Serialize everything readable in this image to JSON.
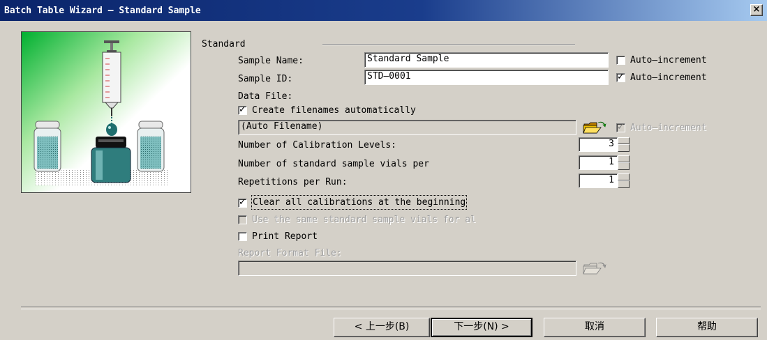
{
  "window": {
    "title": "Batch Table Wizard – Standard Sample",
    "close_label": "×"
  },
  "group": {
    "label": "Standard"
  },
  "sample_name": {
    "label": "Sample Name:",
    "value": "Standard Sample",
    "auto_label": "Auto–increment",
    "auto_checked": false
  },
  "sample_id": {
    "label": "Sample ID:",
    "value": "STD–0001",
    "auto_label": "Auto–increment",
    "auto_checked": true
  },
  "data_file": {
    "label": "Data File:",
    "create_label": "Create filenames automatically",
    "create_checked": true,
    "filename_value": "(Auto Filename)",
    "auto_label": "Auto–increment",
    "auto_checked": true,
    "auto_disabled": true
  },
  "calibration_levels": {
    "label": "Number of Calibration Levels:",
    "value": "3"
  },
  "vials_per": {
    "label": "Number of standard sample vials per",
    "value": "1"
  },
  "repetitions": {
    "label": "Repetitions per Run:",
    "value": "1"
  },
  "clear_calibrations": {
    "label": "Clear all calibrations at the beginning",
    "checked": true
  },
  "same_vials": {
    "label": "Use the same standard sample vials for al",
    "checked": false,
    "disabled": true
  },
  "print_report": {
    "label": "Print Report",
    "checked": false
  },
  "report_format": {
    "label": "Report Format File:",
    "value": "",
    "disabled": true
  },
  "icons": {
    "browse": "folder-open-icon",
    "illustration": "syringe-vials-illustration"
  },
  "buttons": {
    "back": "< 上一步(B)",
    "next": "下一步(N) >",
    "cancel": "取消",
    "help": "帮助"
  },
  "colors": {
    "titlebar_start": "#0a246a",
    "titlebar_end": "#a6caf0",
    "dialog_bg": "#d4d0c8",
    "vial_teal": "#2f7d7d",
    "drop": "#1f6e6e"
  }
}
